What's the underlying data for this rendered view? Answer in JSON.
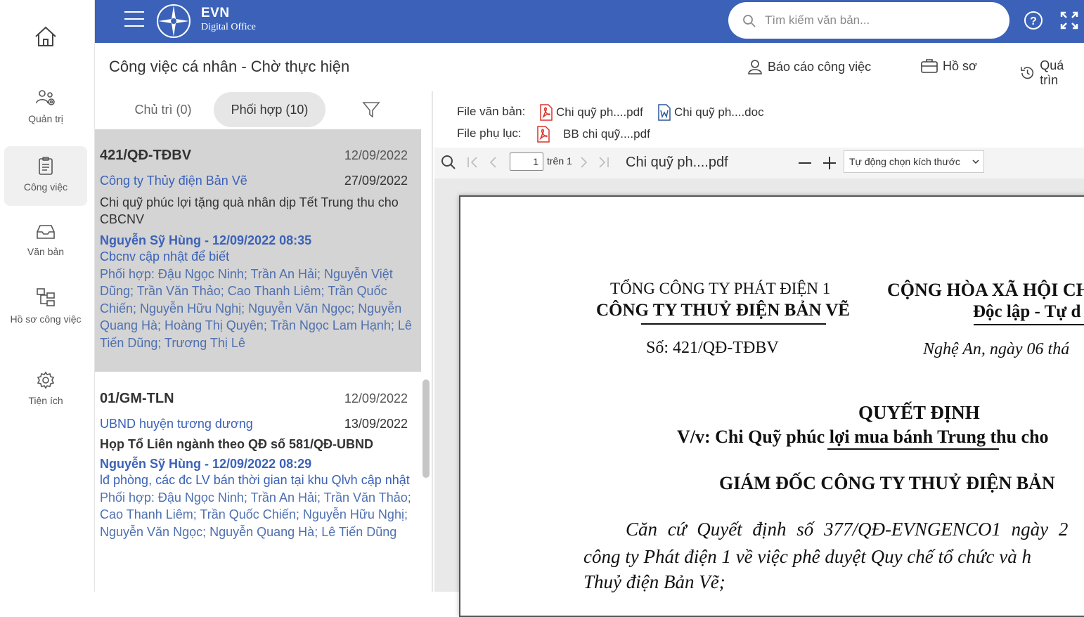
{
  "rail": {
    "items": [
      {
        "label": "Quản trị"
      },
      {
        "label": "Công việc"
      },
      {
        "label": "Văn bản"
      },
      {
        "label": "Hồ sơ công việc"
      },
      {
        "label": "Tiện ích"
      }
    ]
  },
  "header": {
    "brand_title": "EVN",
    "brand_subtitle": "Digital Office",
    "search_placeholder": "Tìm kiếm văn bản...",
    "color": "#3b62b8"
  },
  "page": {
    "title": "Công việc cá nhân - Chờ thực hiện",
    "actions": [
      "Báo cáo công việc",
      "Hồ sơ",
      "Quá trìn"
    ]
  },
  "tabs": [
    {
      "label": "Chủ trì (0)"
    },
    {
      "label": "Phối hợp (10)"
    }
  ],
  "cards": [
    {
      "number": "421/QĐ-TĐBV",
      "date": "12/09/2022",
      "org": "Công ty Thủy điện Bản Vẽ",
      "due": "27/09/2022",
      "subject": "Chi quỹ phúc lợi tặng quà nhân dịp Tết Trung thu cho CBCNV",
      "author": "Nguyễn Sỹ Hùng - 12/09/2022 08:35",
      "note": "Cbcnv cập nhật để biết",
      "people": "Phối hợp: Đậu Ngọc Ninh; Trần An Hải; Nguyễn Việt Dũng; Trần Văn Thảo; Cao Thanh Liêm; Trần Quốc Chiến; Nguyễn Hữu Nghị; Nguyễn Văn Ngọc; Nguyễn Quang Hà; Hoàng Thị Quyên; Trần Ngọc Lam Hạnh; Lê Tiến Dũng; Trương Thị Lê"
    },
    {
      "number": "01/GM-TLN",
      "date": "12/09/2022",
      "org": "UBND huyện tương dương",
      "due": "13/09/2022",
      "subject": "Họp Tổ Liên ngành theo QĐ số 581/QĐ-UBND",
      "author": "Nguyễn Sỹ Hùng - 12/09/2022 08:29",
      "note": "lđ phòng, các đc LV bán thời gian tại khu Qlvh cập nhật",
      "people": "Phối hợp: Đậu Ngọc Ninh; Trần An Hải; Trần Văn Thảo; Cao Thanh Liêm; Trần Quốc Chiến; Nguyễn Hữu Nghị; Nguyễn Văn Ngọc; Nguyễn Quang Hà; Lê Tiến Dũng"
    }
  ],
  "files": {
    "main_label": "File văn bản:",
    "attach_label": "File phụ lục:",
    "main": [
      "Chi quỹ ph....pdf",
      "Chi quỹ ph....doc"
    ],
    "attach": [
      "BB chi quỹ....pdf"
    ]
  },
  "viewer": {
    "page": "1",
    "of": "trên 1",
    "doc_name": "Chi quỹ ph....pdf",
    "zoom": "Tự động chọn kích thước"
  },
  "document": {
    "org_parent": "TỔNG CÔNG TY PHÁT ĐIỆN 1",
    "org": "CÔNG TY THUỶ ĐIỆN BẢN VẼ",
    "nation": "CỘNG HÒA XÃ HỘI CH",
    "motto": "Độc lập - Tự d",
    "number": "Số: 421/QĐ-TĐBV",
    "place_date": "Nghệ An, ngày 06 thá",
    "doc_type": "QUYẾT ĐỊNH",
    "subject": "V/v: Chi Quỹ phúc lợi mua bánh Trung thu cho",
    "authority": "GIÁM ĐỐC CÔNG TY THUỶ ĐIỆN BẢN",
    "body_line1": "Căn cứ Quyết định số 377/QĐ-EVNGENCO1 ngày 2",
    "body_line2": "công ty Phát điện 1 về việc phê duyệt Quy chế tổ chức và h",
    "body_line3": "Thuỷ điện Bản Vẽ;"
  }
}
